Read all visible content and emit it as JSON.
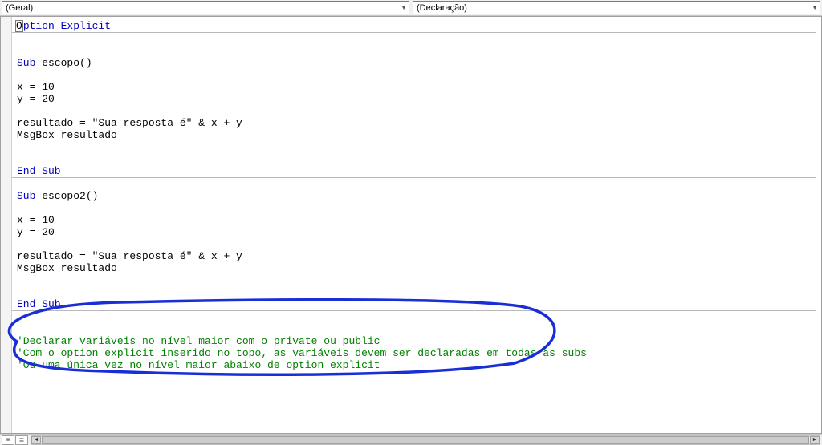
{
  "dropdowns": {
    "left_label": "(Geral)",
    "right_label": "(Declaração)"
  },
  "code": {
    "option_kw": "Option Explicit",
    "sub_kw": "Sub",
    "endsub_kw": "End Sub",
    "escopo1_name": " escopo()",
    "escopo2_name": " escopo2()",
    "line_x": "x = 10",
    "line_y": "y = 20",
    "line_res": "resultado = \"Sua resposta é\" & x + y",
    "line_msg": "MsgBox resultado",
    "comment1": "'Declarar variáveis no nível maior com o private ou public",
    "comment2": "'Com o option explicit inserido no topo, as variáveis devem ser declaradas em todas as subs",
    "comment3": "'Ou uma única vez no nível maior abaixo de option explicit"
  },
  "annotation_color": "#1a2ed8"
}
